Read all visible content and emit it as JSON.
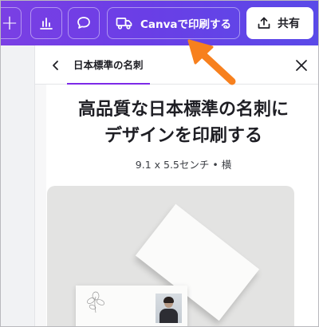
{
  "toolbar": {
    "add_icon": "plus-icon",
    "chart_icon": "bar-chart-icon",
    "comment_icon": "comment-icon",
    "print_button": {
      "icon": "truck-icon",
      "label": "Canvaで印刷する"
    },
    "share_button": {
      "icon": "upload-icon",
      "label": "共有"
    }
  },
  "panel": {
    "back_icon": "chevron-left-icon",
    "tab_label": "日本標準の名刺",
    "close_icon": "close-icon",
    "title_line1": "高品質な日本標準の名刺に",
    "title_line2": "デザインを印刷する",
    "subtitle": "9.1 x 5.5センチ • 横"
  },
  "colors": {
    "toolbar_gradient_start": "#7a3fe4",
    "toolbar_gradient_end": "#5a4ae8",
    "accent": "#7d2ae8",
    "annotation_arrow": "#f7801e"
  }
}
